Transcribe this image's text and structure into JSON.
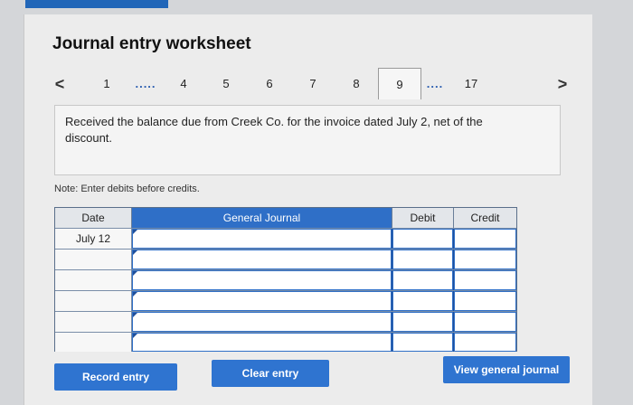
{
  "header": {
    "title": "Journal entry worksheet"
  },
  "pager": {
    "prev_icon": "chevron-left-icon",
    "next_icon": "chevron-right-icon",
    "prev": "<",
    "next": ">",
    "items": [
      "1",
      ".....",
      "4",
      "5",
      "6",
      "7",
      "8",
      "9",
      "....",
      "17"
    ],
    "active": "9"
  },
  "prompt": {
    "text": "Received the balance due from Creek Co. for the invoice dated July 2, net of the discount."
  },
  "note": "Note: Enter debits before credits.",
  "journal": {
    "headers": {
      "date": "Date",
      "account": "General Journal",
      "debit": "Debit",
      "credit": "Credit"
    },
    "rows": [
      {
        "date": "July 12",
        "account": "",
        "debit": "",
        "credit": ""
      },
      {
        "date": "",
        "account": "",
        "debit": "",
        "credit": ""
      },
      {
        "date": "",
        "account": "",
        "debit": "",
        "credit": ""
      },
      {
        "date": "",
        "account": "",
        "debit": "",
        "credit": ""
      },
      {
        "date": "",
        "account": "",
        "debit": "",
        "credit": ""
      },
      {
        "date": "",
        "account": "",
        "debit": "",
        "credit": ""
      }
    ]
  },
  "buttons": {
    "record": "Record entry",
    "clear": "Clear entry",
    "view": "View general journal"
  },
  "colors": {
    "accent": "#2f74d0",
    "header_blue": "#2f6fc7"
  }
}
